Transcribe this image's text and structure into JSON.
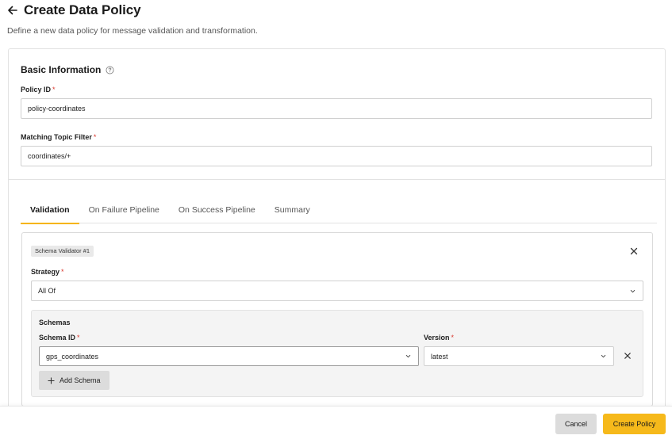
{
  "header": {
    "title": "Create Data Policy",
    "subtitle": "Define a new data policy for message validation and transformation."
  },
  "basic": {
    "title": "Basic Information",
    "policy_id_label": "Policy ID",
    "policy_id_value": "policy-coordinates",
    "topic_label": "Matching Topic Filter",
    "topic_value": "coordinates/+",
    "required_mark": "*"
  },
  "tabs": [
    {
      "label": "Validation",
      "active": true
    },
    {
      "label": "On Failure Pipeline",
      "active": false
    },
    {
      "label": "On Success Pipeline",
      "active": false
    },
    {
      "label": "Summary",
      "active": false
    }
  ],
  "validator": {
    "chip": "Schema Validator #1",
    "strategy_label": "Strategy",
    "strategy_value": "All Of",
    "schemas_title": "Schemas",
    "schema_id_label": "Schema ID",
    "schema_id_value": "gps_coordinates",
    "version_label": "Version",
    "version_value": "latest",
    "add_schema_label": "Add Schema"
  },
  "footer": {
    "cancel_label": "Cancel",
    "create_label": "Create Policy"
  },
  "colors": {
    "accent": "#f6b91b",
    "required": "#d9362b"
  }
}
